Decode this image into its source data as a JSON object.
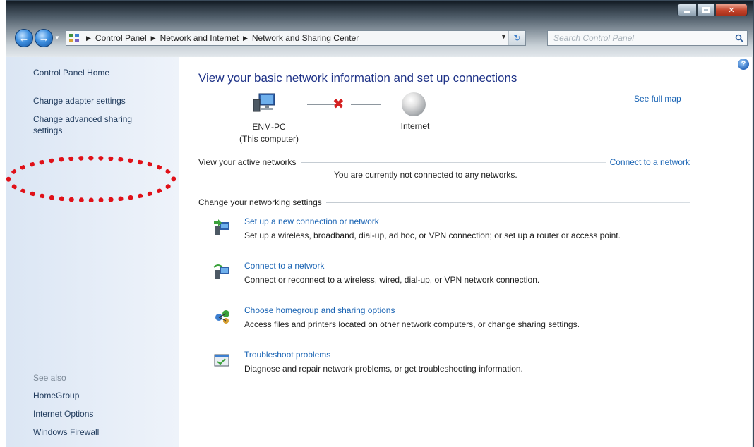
{
  "window": {
    "caption_buttons": [
      "minimize-icon",
      "maximize-icon",
      "close-icon"
    ]
  },
  "address_bar": {
    "crumbs": [
      "Control Panel",
      "Network and Internet",
      "Network and Sharing Center"
    ],
    "search_placeholder": "Search Control Panel"
  },
  "sidebar": {
    "home": "Control Panel Home",
    "links": [
      "Change adapter settings",
      "Change advanced sharing settings"
    ],
    "see_also_label": "See also",
    "see_also": [
      "HomeGroup",
      "Internet Options",
      "Windows Firewall"
    ],
    "highlight_color": "#e01018"
  },
  "main": {
    "title": "View your basic network information and set up connections",
    "see_full_map": "See full map",
    "map": {
      "computer_name": "ENM-PC",
      "computer_sub": "(This computer)",
      "internet_label": "Internet",
      "connection_state": "disconnected"
    },
    "active_networks": {
      "label": "View your active networks",
      "link": "Connect to a network",
      "status": "You are currently not connected to any networks."
    },
    "networking_settings": {
      "label": "Change your networking settings",
      "tasks": [
        {
          "title": "Set up a new connection or network",
          "desc": "Set up a wireless, broadband, dial-up, ad hoc, or VPN connection; or set up a router or access point.",
          "icon": "network-setup-icon"
        },
        {
          "title": "Connect to a network",
          "desc": "Connect or reconnect to a wireless, wired, dial-up, or VPN network connection.",
          "icon": "connect-network-icon"
        },
        {
          "title": "Choose homegroup and sharing options",
          "desc": "Access files and printers located on other network computers, or change sharing settings.",
          "icon": "homegroup-icon"
        },
        {
          "title": "Troubleshoot problems",
          "desc": "Diagnose and repair network problems, or get troubleshooting information.",
          "icon": "troubleshoot-icon"
        }
      ]
    }
  },
  "colors": {
    "link": "#1a64b4",
    "title": "#1e3287",
    "sidebar_bg": "#dbe6f4"
  }
}
